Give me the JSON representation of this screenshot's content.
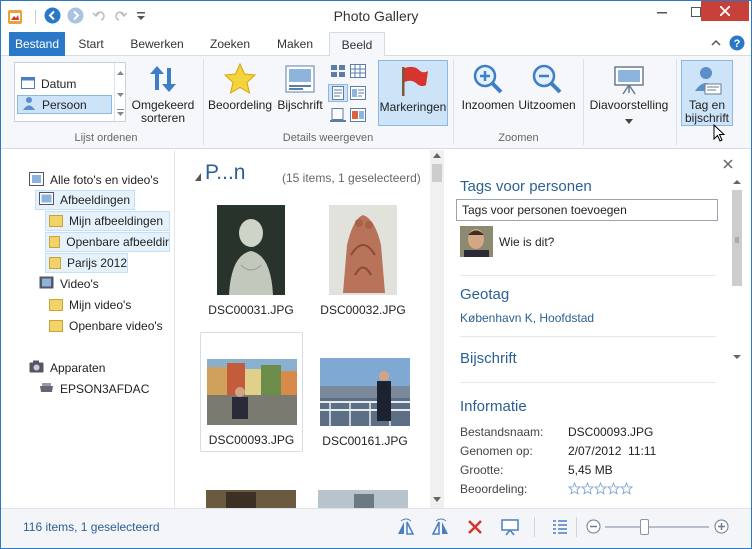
{
  "window": {
    "title": "Photo Gallery"
  },
  "tabs": [
    "Bestand",
    "Start",
    "Bewerken",
    "Zoeken",
    "Maken",
    "Beeld"
  ],
  "ribbon": {
    "list_sort": {
      "items": [
        "Datum",
        "Persoon"
      ],
      "reverse_label_1": "Omgekeerd",
      "reverse_label_2": "sorteren",
      "group": "Lijst ordenen"
    },
    "details": {
      "rating": "Beoordeling",
      "caption": "Bijschrift",
      "tags": "Markeringen",
      "group": "Details weergeven"
    },
    "zoom": {
      "in": "Inzoomen",
      "out": "Uitzoomen",
      "group": "Zoomen"
    },
    "slideshow": "Diavoorstelling",
    "tag_1": "Tag en",
    "tag_2": "bijschrift"
  },
  "nav": {
    "all": "Alle foto's en video's",
    "pictures": "Afbeeldingen",
    "my_pictures": "Mijn afbeeldingen",
    "public_pictures": "Openbare afbeeldir",
    "paris": "Parijs 2012",
    "videos": "Video's",
    "my_videos": "Mijn video's",
    "public_videos": "Openbare video's",
    "devices": "Apparaten",
    "device": "EPSON3AFDAC"
  },
  "content": {
    "group_title": "P...n",
    "group_count": "(15 items, 1 geselecteerd)",
    "thumbs": [
      "DSC00031.JPG",
      "DSC00032.JPG",
      "DSC00093.JPG",
      "DSC00161.JPG"
    ]
  },
  "pane": {
    "people_header": "Tags voor personen",
    "people_input": "Tags voor personen toevoegen",
    "who": "Wie is dit?",
    "geotag_header": "Geotag",
    "geotag": "København K, Hoofdstad",
    "caption_header": "Bijschrift",
    "info_header": "Informatie",
    "info": [
      {
        "k": "Bestandsnaam:",
        "v": "DSC00093.JPG"
      },
      {
        "k": "Genomen op:",
        "v": "2/07/2012  11:11"
      },
      {
        "k": "Grootte:",
        "v": "5,45 MB"
      },
      {
        "k": "Beoordeling:",
        "v": ""
      }
    ],
    "rating_stars": 0
  },
  "status": {
    "text": "116 items, 1 geselecteerd",
    "zoom_level": 0.37
  },
  "colors": {
    "accent": "#2b78c6",
    "tag_red": "#d6352d",
    "header_blue": "#2b5f95"
  }
}
